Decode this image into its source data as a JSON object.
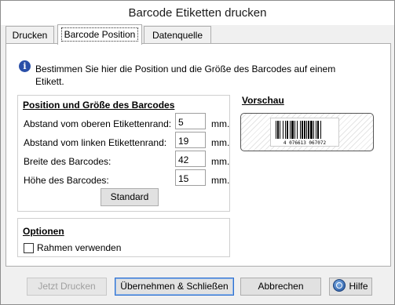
{
  "window": {
    "title": "Barcode Etiketten drucken"
  },
  "tabs": [
    {
      "label": "Drucken"
    },
    {
      "label": "Barcode Position",
      "active": true
    },
    {
      "label": "Datenquelle"
    }
  ],
  "info": {
    "icon": "info-icon",
    "text": "Bestimmen Sie hier die Position und die Größe des Barcodes auf einem Etikett."
  },
  "position_group": {
    "title": "Position und Größe des Barcodes",
    "rows": [
      {
        "label": "Abstand vom oberen Etikettenrand:",
        "value": "5",
        "unit": "mm."
      },
      {
        "label": "Abstand vom linken Etikettenrand:",
        "value": "19",
        "unit": "mm."
      },
      {
        "label": "Breite des Barcodes:",
        "value": "42",
        "unit": "mm."
      },
      {
        "label": "Höhe des Barcodes:",
        "value": "15",
        "unit": "mm."
      }
    ],
    "standard_button": "Standard"
  },
  "options_group": {
    "title": "Optionen",
    "frame_checkbox": {
      "label": "Rahmen verwenden",
      "checked": false
    }
  },
  "preview": {
    "title": "Vorschau",
    "barcode_digits": "4 076613 067072"
  },
  "footer": {
    "print_now": "Jetzt Drucken",
    "apply_close": "Übernehmen & Schließen",
    "cancel": "Abbrechen",
    "help": "Hilfe"
  }
}
